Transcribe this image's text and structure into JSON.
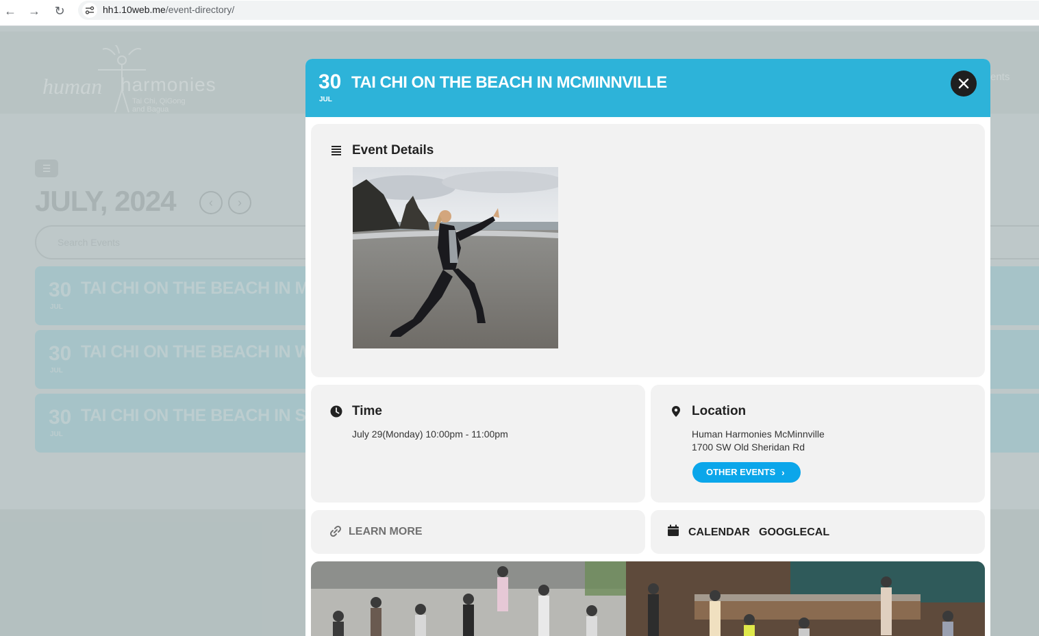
{
  "browser": {
    "url_host": "hh1.10web.me",
    "url_path": "/event-directory/"
  },
  "site": {
    "logo_word1": "human",
    "logo_word2": "harmonies",
    "logo_tag1": "Tai Chi, QiGong",
    "logo_tag2": "and Bagua",
    "header_link": "ents"
  },
  "calendar": {
    "month_title": "JULY, 2024",
    "search_placeholder": "Search Events",
    "events": [
      {
        "day": "30",
        "month": "JUL",
        "title": "TAI CHI ON THE BEACH IN M"
      },
      {
        "day": "30",
        "month": "JUL",
        "title": "TAI CHI ON THE BEACH IN W"
      },
      {
        "day": "30",
        "month": "JUL",
        "title": "TAI CHI ON THE BEACH IN SV"
      }
    ]
  },
  "modal": {
    "day": "30",
    "month": "JUL",
    "title": "TAI CHI ON THE BEACH IN MCMINNVILLE",
    "details_title": "Event Details",
    "time_title": "Time",
    "time_value": "July 29(Monday) 10:00pm - 11:00pm",
    "location_title": "Location",
    "location_name": "Human Harmonies McMinnville",
    "location_address": "1700 SW Old Sheridan Rd",
    "other_events_label": "OTHER EVENTS",
    "learn_more_label": "LEARN MORE",
    "calendar_label": "CALENDAR",
    "googlecal_label": "GOOGLECAL"
  },
  "colors": {
    "modal_header": "#2db3d9",
    "button_blue": "#0ba6ea"
  }
}
